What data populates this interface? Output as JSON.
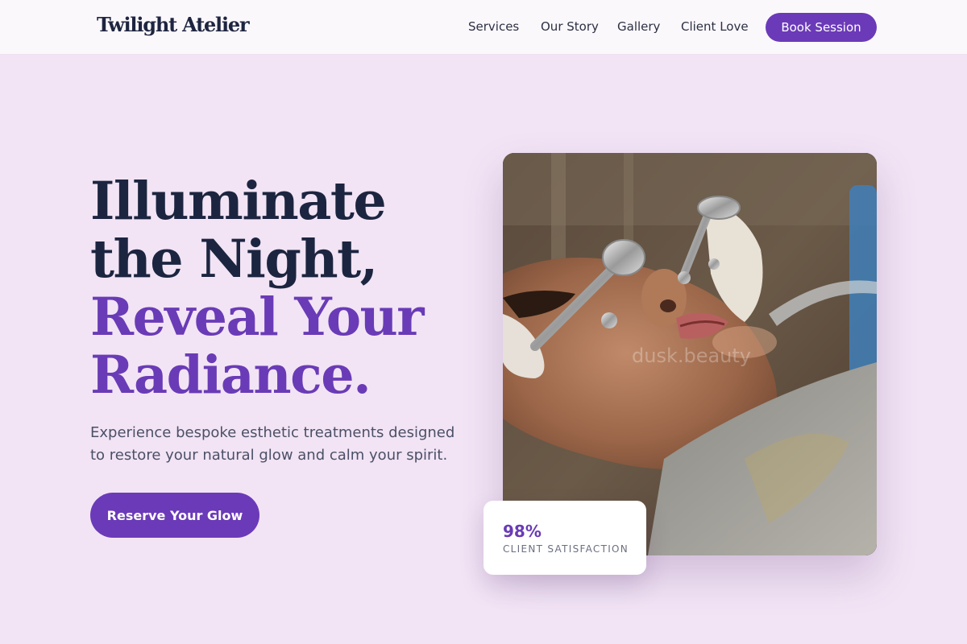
{
  "header": {
    "logo": "Twilight Atelier",
    "nav": [
      "Services",
      "Our Story",
      "Gallery",
      "Client Love"
    ],
    "book_label": "Book Session"
  },
  "hero": {
    "headline_line1": "Illuminate",
    "headline_line2": "the Night,",
    "headline_line3": "Reveal Your",
    "headline_line4": "Radiance.",
    "subtext": "Experience bespoke esthetic treatments designed to restore your natural glow and calm your spirit.",
    "cta_label": "Reserve Your Glow"
  },
  "photo": {
    "watermark": "dusk.beauty"
  },
  "stat": {
    "value": "98%",
    "label": "CLIENT SATISFACTION"
  },
  "colors": {
    "background": "#f2e4f5",
    "accent": "#6b3ab8",
    "heading_dark": "#1c2540"
  }
}
